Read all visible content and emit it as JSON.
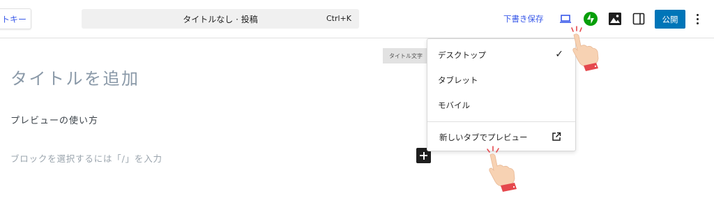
{
  "topbar": {
    "left_button_label": "トキー",
    "command": {
      "title": "タイトルなし · 投稿",
      "shortcut": "Ctrl+K"
    },
    "save_draft_label": "下書き保存",
    "publish_label": "公開"
  },
  "editor": {
    "word_count_label": "タイトル文字",
    "title_placeholder": "タイトルを追加",
    "heading_text": "プレビューの使い方",
    "block_placeholder": "ブロックを選択するには「/」を入力"
  },
  "preview_menu": {
    "items": [
      {
        "label": "デスクトップ",
        "selected": true
      },
      {
        "label": "タブレット",
        "selected": false
      },
      {
        "label": "モバイル",
        "selected": false
      }
    ],
    "check_mark": "✓",
    "new_tab_label": "新しいタブでプレビュー"
  },
  "icons": {
    "preview": "desktop-icon",
    "jetpack": "jetpack-icon",
    "featured_image": "image-icon",
    "settings": "sidebar-toggle-icon",
    "options": "kebab-menu-icon",
    "inserter": "plus-icon",
    "external": "external-link-icon",
    "pointer": "hand-pointer-icon"
  },
  "colors": {
    "accent": "#3858e9",
    "publish": "#0075b8",
    "jetpack": "#069e08",
    "hand_skin": "#f7d2b3",
    "hand_cuff": "#e5484d"
  }
}
